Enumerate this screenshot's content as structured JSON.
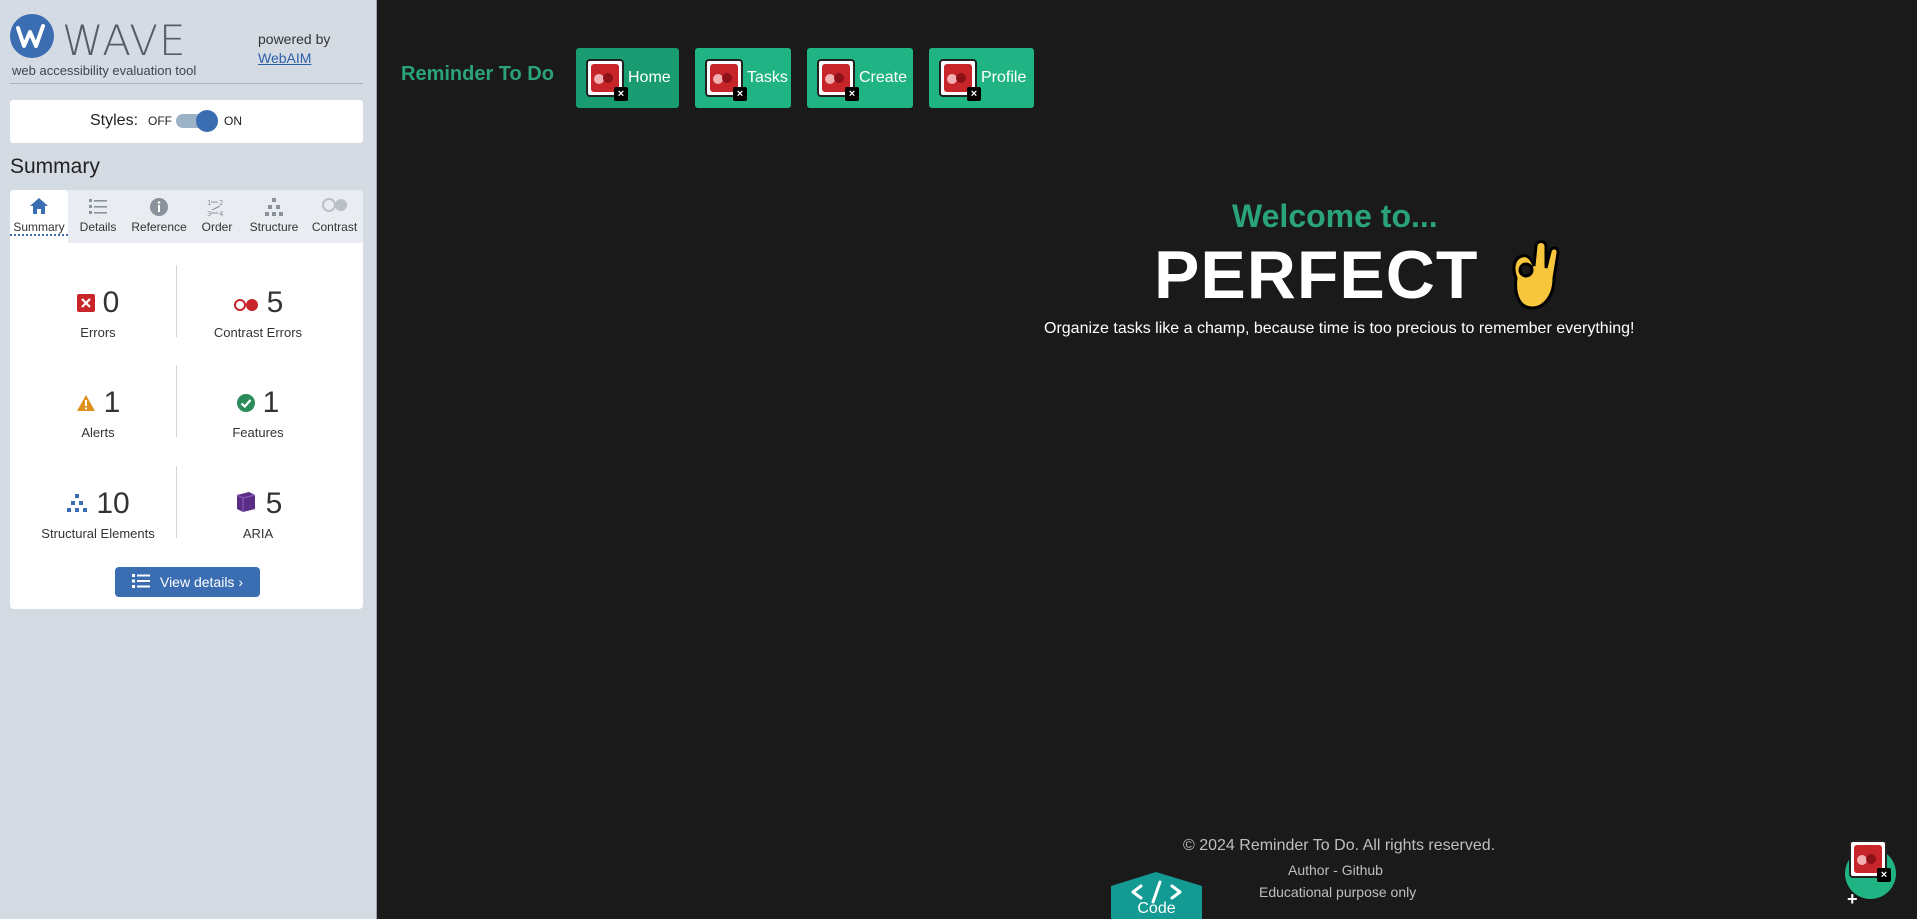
{
  "wave": {
    "logo_text": "WAVE",
    "tagline": "web accessibility evaluation tool",
    "powered_by": "powered by",
    "webaim_link": "WebAIM",
    "styles_label": "Styles:",
    "styles_off": "OFF",
    "styles_on": "ON",
    "styles_enabled": true,
    "summary_title": "Summary",
    "tabs": [
      {
        "label": "Summary",
        "icon": "home-icon",
        "active": true
      },
      {
        "label": "Details",
        "icon": "list-icon",
        "active": false
      },
      {
        "label": "Reference",
        "icon": "info-icon",
        "active": false
      },
      {
        "label": "Order",
        "icon": "order-icon",
        "active": false
      },
      {
        "label": "Structure",
        "icon": "structure-icon",
        "active": false
      },
      {
        "label": "Contrast",
        "icon": "contrast-icon",
        "active": false
      }
    ],
    "stats": {
      "errors": {
        "value": "0",
        "label": "Errors",
        "color": "#c8252b"
      },
      "contrast_errors": {
        "value": "5",
        "label": "Contrast Errors",
        "color": "#c8252b"
      },
      "alerts": {
        "value": "1",
        "label": "Alerts",
        "color": "#e0911d"
      },
      "features": {
        "value": "1",
        "label": "Features",
        "color": "#2a8c5a"
      },
      "structural": {
        "value": "10",
        "label": "Structural Elements",
        "color": "#3a6db2"
      },
      "aria": {
        "value": "5",
        "label": "ARIA",
        "color": "#5a2d86"
      }
    },
    "view_details": "View details ›",
    "accent": "#3a6db2"
  },
  "app": {
    "brand": "Reminder To Do",
    "nav": [
      {
        "label": "Home",
        "current": true
      },
      {
        "label": "Tasks",
        "current": false
      },
      {
        "label": "Create",
        "current": false
      },
      {
        "label": "Profile",
        "current": false
      }
    ],
    "welcome": "Welcome to...",
    "headline": "PERFECT",
    "headline_emoji": "ok-hand-icon",
    "tagline": "Organize tasks like a champ, because time is too precious to remember everything!",
    "footer": {
      "copyright": "© 2024 Reminder To Do. All rights reserved.",
      "author_prefix": "Author - ",
      "author_link": "Github",
      "edu": "Educational purpose only"
    },
    "code_tab": "Code",
    "fab_plus": "+",
    "accent": "#20b383",
    "background": "#1a1a1a"
  }
}
